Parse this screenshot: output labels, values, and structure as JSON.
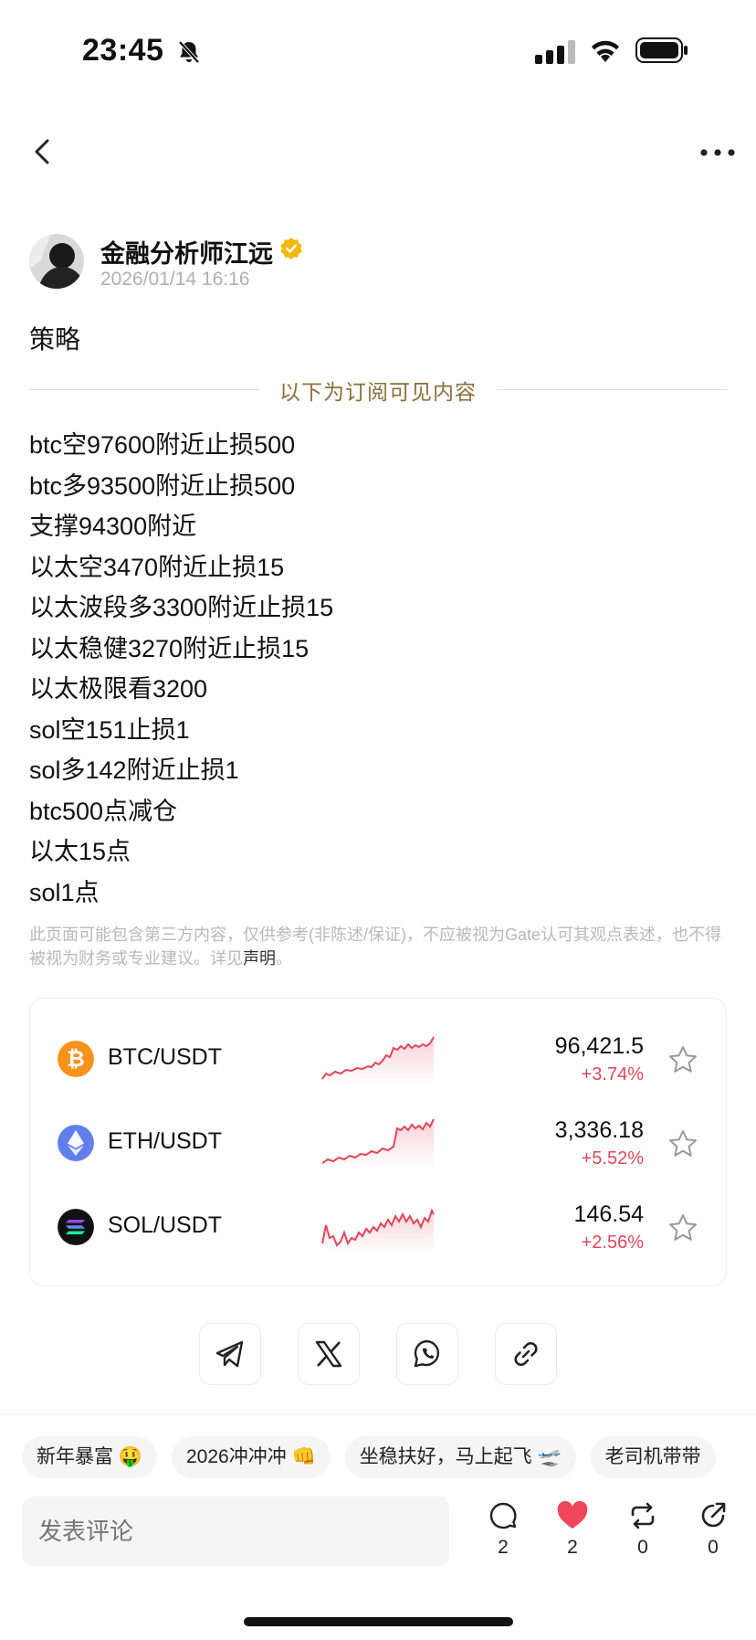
{
  "status_bar": {
    "time": "23:45"
  },
  "author": {
    "name": "金融分析师江远",
    "timestamp": "2026/01/14 16:16"
  },
  "post": {
    "title": "策略",
    "subscriber_divider": "以下为订阅可见内容",
    "lines": [
      "btc空97600附近止损500",
      "btc多93500附近止损500",
      "支撑94300附近",
      "以太空3470附近止损15",
      "以太波段多3300附近止损15",
      "以太稳健3270附近止损15",
      "以太极限看3200",
      "sol空151止损1",
      "sol多142附近止损1",
      "btc500点减仓",
      "以太15点",
      "sol1点"
    ],
    "disclaimer": "此页面可能包含第三方内容，仅供参考(非陈述/保证)，不应被视为Gate认可其观点表述，也不得被视为财务或专业建议。详见",
    "disclaimer_link": "声明",
    "disclaimer_end": "。"
  },
  "markets": [
    {
      "pair": "BTC/USDT",
      "price": "96,421.5",
      "change": "+3.74%",
      "icon": "bitcoin-icon",
      "color": "#f7931a"
    },
    {
      "pair": "ETH/USDT",
      "price": "3,336.18",
      "change": "+5.52%",
      "icon": "ethereum-icon",
      "color": "#627eea"
    },
    {
      "pair": "SOL/USDT",
      "price": "146.54",
      "change": "+2.56%",
      "icon": "solana-icon",
      "color": "#111111"
    }
  ],
  "share": [
    "telegram-icon",
    "x-icon",
    "whatsapp-icon",
    "link-icon"
  ],
  "tags": [
    "新年暴富 🤑",
    "2026冲冲冲 👊",
    "坐稳扶好，马上起飞 🛫",
    "老司机带带"
  ],
  "comment": {
    "placeholder": "发表评论"
  },
  "actions": {
    "comments": "2",
    "likes": "2",
    "reposts": "0",
    "shares": "0"
  },
  "colors": {
    "accent_gold": "#8b6f3e",
    "up_red": "#e0475a",
    "like_red": "#f0455a"
  }
}
